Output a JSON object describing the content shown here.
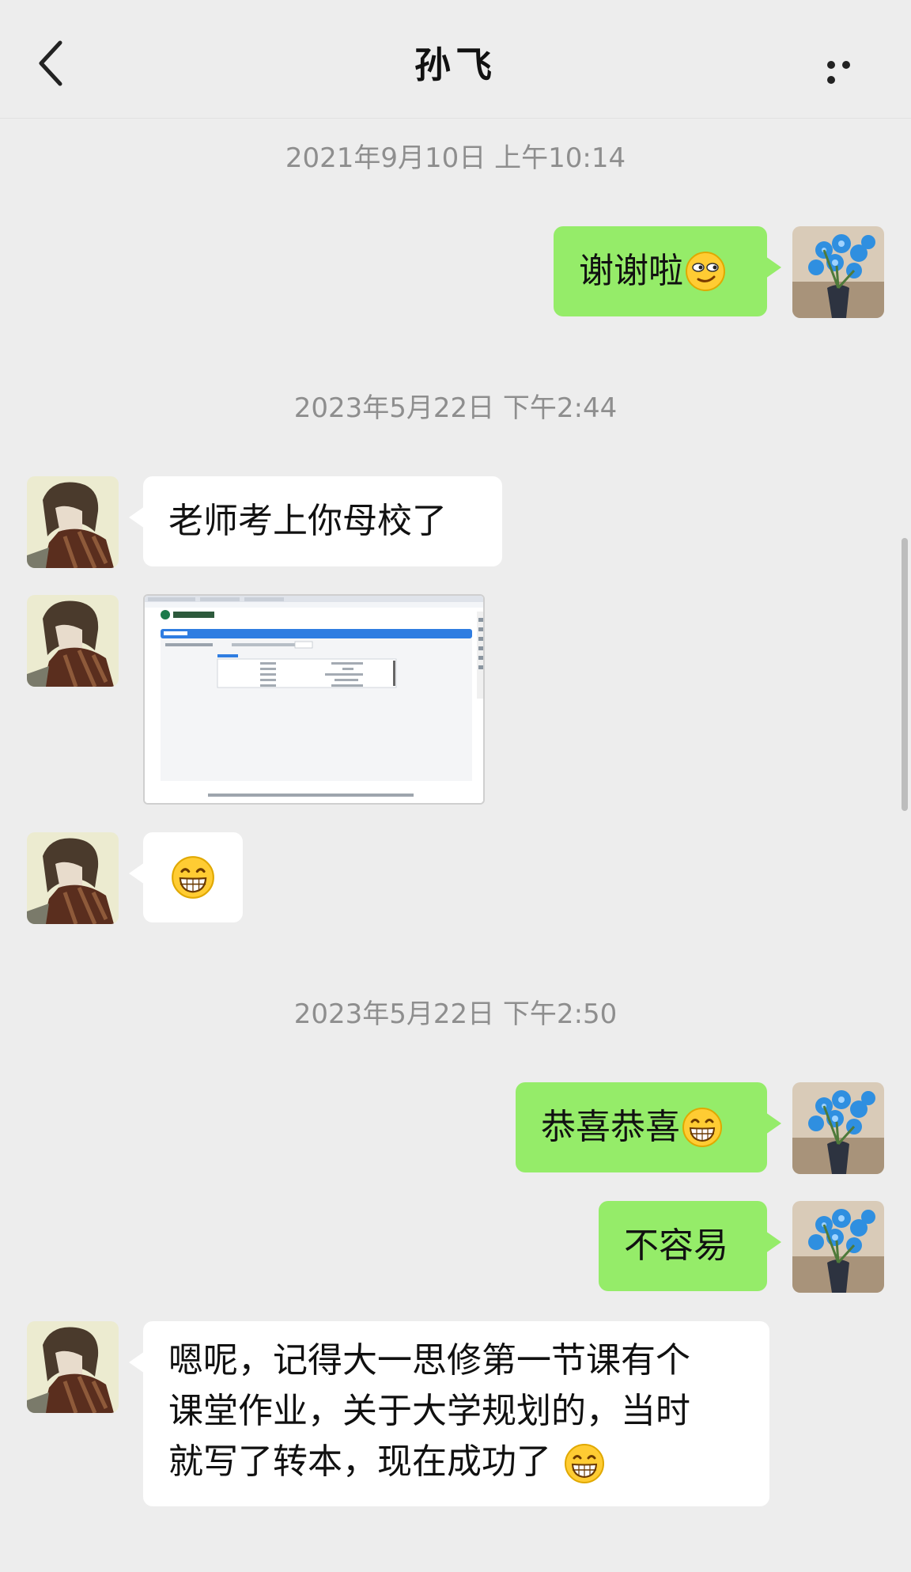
{
  "header": {
    "title": "孙飞",
    "back_icon": "chevron-left-icon",
    "more_icon": "more-dots-icon"
  },
  "messages": {
    "ts1": "2021年9月10日 上午10:14",
    "m1": "谢谢啦",
    "ts2": "2023年5月22日 下午2:44",
    "m2": "老师考上你母校了",
    "m4_emoji": "grinning-emoji",
    "ts3": "2023年5月22日 下午2:50",
    "m5": "恭喜恭喜",
    "m6": "不容易",
    "m7_lines": [
      "嗯呢，记得大一思修第一节课有个",
      "课堂作业，关于大学规划的，当时",
      "就写了转本，现在成功了"
    ]
  },
  "colors": {
    "background": "#ededed",
    "my_bubble": "#95ec69",
    "other_bubble": "#ffffff",
    "timestamp": "#8e8e8e"
  }
}
